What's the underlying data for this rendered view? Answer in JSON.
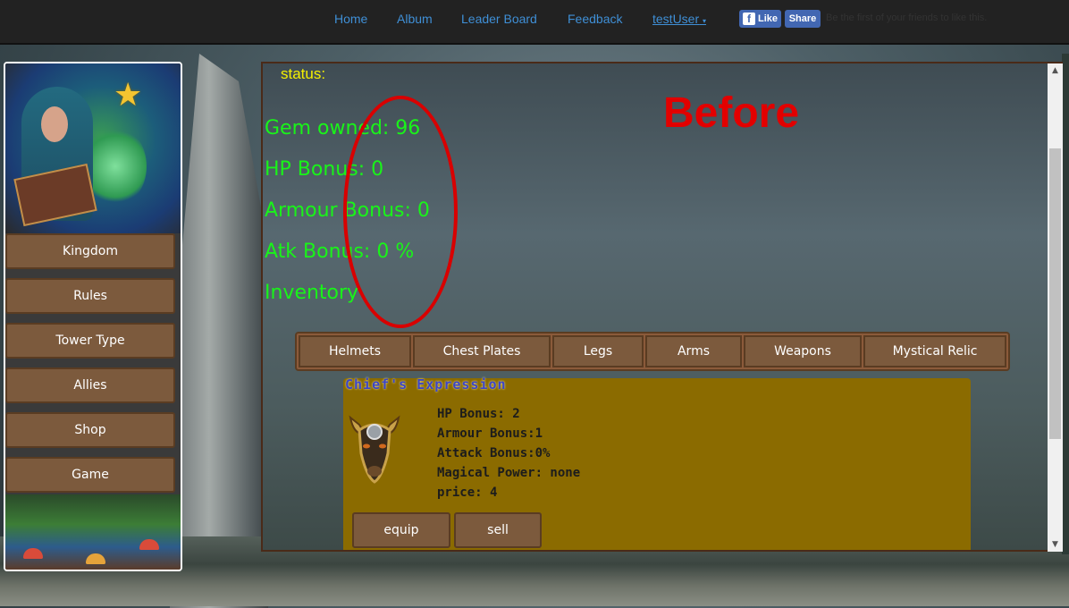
{
  "nav": {
    "home": "Home",
    "album": "Album",
    "leaderboard": "Leader Board",
    "feedback": "Feedback",
    "user": "testUser",
    "user_caret": "▾",
    "fb_like": "Like",
    "fb_share": "Share",
    "fb_logo": "f",
    "fb_text": "Be the first of your friends to like this."
  },
  "sidebar": {
    "star_icon": "★",
    "items": [
      {
        "label": "Kingdom"
      },
      {
        "label": "Rules"
      },
      {
        "label": "Tower Type"
      },
      {
        "label": "Allies"
      },
      {
        "label": "Shop"
      },
      {
        "label": "Game"
      }
    ]
  },
  "main": {
    "status_label": "status:",
    "gem": "Gem owned: 96",
    "hp": "HP Bonus: 0",
    "armour": "Armour Bonus: 0",
    "atk": "Atk Bonus: 0 %",
    "inventory": "Inventory",
    "annotation": "Before",
    "annotation_color": "#e20000",
    "tabs": [
      {
        "label": "Helmets"
      },
      {
        "label": "Chest Plates"
      },
      {
        "label": "Legs"
      },
      {
        "label": "Arms"
      },
      {
        "label": "Weapons"
      },
      {
        "label": "Mystical Relic"
      }
    ],
    "item": {
      "name": "Chief's Expression",
      "icon": "bull-helmet-icon",
      "hp": "HP Bonus: 2",
      "armour": "Armour Bonus:1",
      "attack": "Attack Bonus:0%",
      "magic": "Magical Power: none",
      "price": "price: 4",
      "equip": "equip",
      "sell": "sell"
    }
  },
  "colors": {
    "stat_green": "#19f419",
    "status_yellow": "#f4f000",
    "button_brown": "#7c5a3d",
    "item_gold": "#8b6b00",
    "link_blue": "#3f8fd6"
  }
}
